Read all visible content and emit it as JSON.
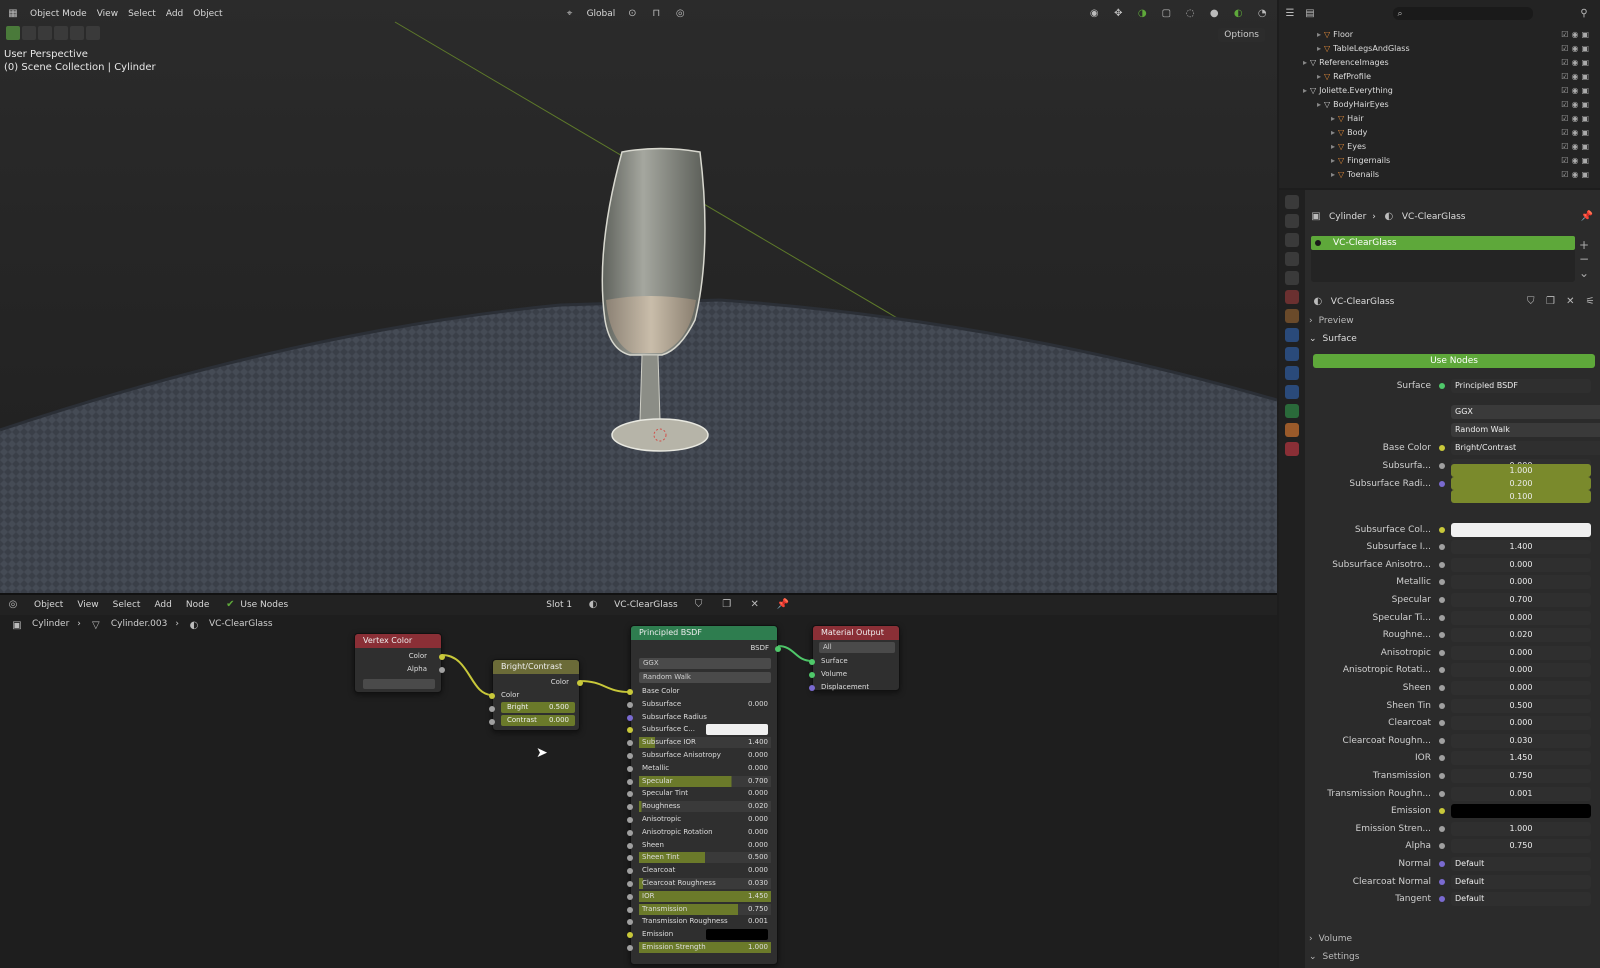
{
  "viewport": {
    "header": {
      "editor_icon": "3d-viewport-icon",
      "mode": "Object Mode",
      "menus": [
        "View",
        "Select",
        "Add",
        "Object"
      ],
      "orientation": "Global",
      "options": "Options"
    },
    "info_line1": "User Perspective",
    "info_line2": "(0) Scene Collection | Cylinder"
  },
  "outliner": {
    "rows": [
      {
        "label": "Floor"
      },
      {
        "label": "TableLegsAndGlass"
      },
      {
        "label": "ReferenceImages"
      },
      {
        "label": "RefProfile"
      },
      {
        "label": "Joliette.Everything"
      },
      {
        "label": "BodyHairEyes"
      },
      {
        "label": "Hair"
      },
      {
        "label": "Body"
      },
      {
        "label": "Eyes"
      },
      {
        "label": "Fingernails"
      },
      {
        "label": "Toenails"
      }
    ]
  },
  "properties": {
    "breadcrumb_object": "Cylinder",
    "breadcrumb_material": "VC-ClearGlass",
    "slot_name": "VC-ClearGlass",
    "datablock_name": "VC-ClearGlass",
    "preview_label": "Preview",
    "surface_label": "Surface",
    "use_nodes": "Use Nodes",
    "surface_shader_label": "Surface",
    "surface_shader": "Principled BSDF",
    "distribution": "GGX",
    "subsurface_method": "Random Walk",
    "base_color_label": "Base Color",
    "base_color_link": "Bright/Contrast",
    "rows": [
      {
        "label": "Subsurfa...",
        "value": "0.000",
        "fill": 0
      },
      {
        "label": "Subsurface Col...",
        "value": "",
        "swatch": "#f0f0f0"
      },
      {
        "label": "Subsurface I...",
        "value": "1.400",
        "fill": 0.1
      },
      {
        "label": "Subsurface Anisotro...",
        "value": "0.000",
        "fill": 0
      },
      {
        "label": "Metallic",
        "value": "0.000",
        "fill": 0
      },
      {
        "label": "Specular",
        "value": "0.700",
        "fill": 0.7
      },
      {
        "label": "Specular Ti...",
        "value": "0.000",
        "fill": 0
      },
      {
        "label": "Roughne...",
        "value": "0.020",
        "fill": 0.02
      },
      {
        "label": "Anisotropic",
        "value": "0.000",
        "fill": 0
      },
      {
        "label": "Anisotropic Rotati...",
        "value": "0.000",
        "fill": 0
      },
      {
        "label": "Sheen",
        "value": "0.000",
        "fill": 0
      },
      {
        "label": "Sheen Tin",
        "value": "0.500",
        "fill": 0.5
      },
      {
        "label": "Clearcoat",
        "value": "0.000",
        "fill": 0
      },
      {
        "label": "Clearcoat Roughn...",
        "value": "0.030",
        "fill": 0.03
      },
      {
        "label": "IOR",
        "value": "1.450",
        "fill": 1
      },
      {
        "label": "Transmission",
        "value": "0.750",
        "fill": 0.75
      },
      {
        "label": "Transmission Roughn...",
        "value": "0.001",
        "fill": 0
      },
      {
        "label": "Emission",
        "value": "",
        "swatch": "#000000"
      },
      {
        "label": "Emission Stren...",
        "value": "1.000",
        "fill": 1
      },
      {
        "label": "Alpha",
        "value": "0.750",
        "fill": 0.75
      },
      {
        "label": "Normal",
        "value": "Default",
        "link": true
      },
      {
        "label": "Clearcoat Normal",
        "value": "Default",
        "link": true
      },
      {
        "label": "Tangent",
        "value": "Default",
        "link": true
      }
    ],
    "subsurface_radius_label": "Subsurface Radi...",
    "subsurface_radius": [
      "1.000",
      "0.200",
      "0.100"
    ],
    "volume_label": "Volume",
    "settings_label": "Settings"
  },
  "node_editor": {
    "header": {
      "mode": "Object",
      "menus": [
        "View",
        "Select",
        "Add",
        "Node"
      ],
      "use_nodes": "Use Nodes",
      "slot": "Slot 1",
      "material": "VC-ClearGlass"
    },
    "breadcrumb": [
      "Cylinder",
      "Cylinder.003",
      "VC-ClearGlass"
    ],
    "vertex_color": {
      "title": "Vertex Color",
      "out_color": "Color",
      "out_alpha": "Alpha"
    },
    "bright_contrast": {
      "title": "Bright/Contrast",
      "out_color": "Color",
      "in_color": "Color",
      "bright_label": "Bright",
      "bright": "0.500",
      "contrast_label": "Contrast",
      "contrast": "0.000"
    },
    "principled": {
      "title": "Principled BSDF",
      "out": "BSDF",
      "distribution": "GGX",
      "method": "Random Walk",
      "rows": [
        {
          "label": "Base Color",
          "value": ""
        },
        {
          "label": "Subsurface",
          "value": "0.000"
        },
        {
          "label": "Subsurface Radius",
          "value": ""
        },
        {
          "label": "Subsurface C...",
          "value": ""
        },
        {
          "label": "Subsurface IOR",
          "value": "1.400"
        },
        {
          "label": "Subsurface Anisotropy",
          "value": "0.000"
        },
        {
          "label": "Metallic",
          "value": "0.000"
        },
        {
          "label": "Specular",
          "value": "0.700"
        },
        {
          "label": "Specular Tint",
          "value": "0.000"
        },
        {
          "label": "Roughness",
          "value": "0.020"
        },
        {
          "label": "Anisotropic",
          "value": "0.000"
        },
        {
          "label": "Anisotropic Rotation",
          "value": "0.000"
        },
        {
          "label": "Sheen",
          "value": "0.000"
        },
        {
          "label": "Sheen Tint",
          "value": "0.500"
        },
        {
          "label": "Clearcoat",
          "value": "0.000"
        },
        {
          "label": "Clearcoat Roughness",
          "value": "0.030"
        },
        {
          "label": "IOR",
          "value": "1.450"
        },
        {
          "label": "Transmission",
          "value": "0.750"
        },
        {
          "label": "Transmission Roughness",
          "value": "0.001"
        },
        {
          "label": "Emission",
          "value": ""
        },
        {
          "label": "Emission Strength",
          "value": "1.000"
        }
      ]
    },
    "material_output": {
      "title": "Material Output",
      "target": "All",
      "in_surface": "Surface",
      "in_volume": "Volume",
      "in_displacement": "Displacement"
    }
  },
  "colors": {
    "accent_green": "#5ea83a",
    "slider_fill": "#7a8a2c",
    "node_shader": "#2e7d4f",
    "node_input": "#8a2f36",
    "node_color": "#6b6b38",
    "node_output": "#8a2f36"
  }
}
